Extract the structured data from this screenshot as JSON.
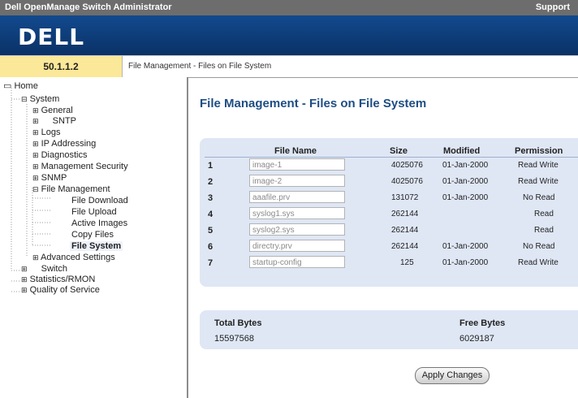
{
  "header": {
    "app_title": "Dell OpenManage Switch Administrator",
    "support_link": "Support",
    "logo_text": "DELL"
  },
  "ip_address": "50.1.1.2",
  "breadcrumb": "File Management - Files on File System",
  "sidebar": {
    "home": "Home",
    "system": "System",
    "general": "General",
    "sntp": "SNTP",
    "logs": "Logs",
    "ip_addressing": "IP Addressing",
    "diagnostics": "Diagnostics",
    "management_security": "Management Security",
    "snmp": "SNMP",
    "file_management": "File Management",
    "file_download": "File Download",
    "file_upload": "File Upload",
    "active_images": "Active Images",
    "copy_files": "Copy Files",
    "file_system": "File System",
    "advanced_settings": "Advanced Settings",
    "switch": "Switch",
    "statistics_rmon": "Statistics/RMON",
    "quality_of_service": "Quality of Service"
  },
  "main": {
    "title": "File Management - Files on File System",
    "columns": {
      "file_name": "File Name",
      "size": "Size",
      "modified": "Modified",
      "permission": "Permission"
    },
    "rows": [
      {
        "num": "1",
        "file": "image-1",
        "size": "4025076",
        "modified": "01-Jan-2000",
        "permission": "Read Write"
      },
      {
        "num": "2",
        "file": "image-2",
        "size": "4025076",
        "modified": "01-Jan-2000",
        "permission": "Read Write"
      },
      {
        "num": "3",
        "file": "aaafile.prv",
        "size": "131072",
        "modified": "01-Jan-2000",
        "permission": "No Read"
      },
      {
        "num": "4",
        "file": "syslog1.sys",
        "size": "262144",
        "modified": "",
        "permission": "Read"
      },
      {
        "num": "5",
        "file": "syslog2.sys",
        "size": "262144",
        "modified": "",
        "permission": "Read"
      },
      {
        "num": "6",
        "file": "directry.prv",
        "size": "262144",
        "modified": "01-Jan-2000",
        "permission": "No Read"
      },
      {
        "num": "7",
        "file": "startup-config",
        "size": "125",
        "modified": "01-Jan-2000",
        "permission": "Read Write"
      }
    ],
    "totals": {
      "total_label": "Total Bytes",
      "total_value": "15597568",
      "free_label": "Free Bytes",
      "free_value": "6029187"
    },
    "apply_button": "Apply Changes"
  }
}
